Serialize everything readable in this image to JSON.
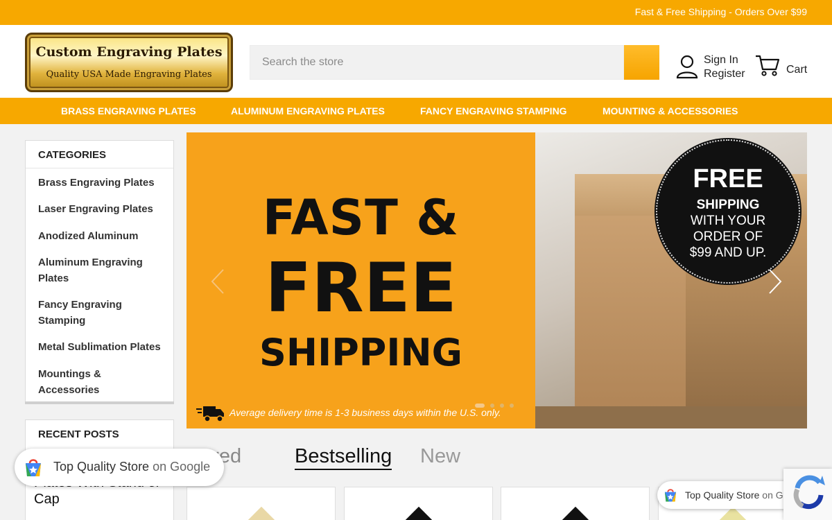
{
  "top_banner": {
    "text": "Fast & Free Shipping - Orders Over $99"
  },
  "logo": {
    "title": "Custom Engraving Plates",
    "tagline": "Quality USA Made Engraving Plates",
    "icon": "logo-plate"
  },
  "search": {
    "placeholder": "Search the store",
    "button_icon": "search-icon"
  },
  "account": {
    "icon": "user-icon",
    "sign_in": "Sign In",
    "register": "Register"
  },
  "cart": {
    "icon": "cart-icon",
    "label": "Cart"
  },
  "nav": {
    "items": [
      {
        "label": "BRASS ENGRAVING PLATES"
      },
      {
        "label": "ALUMINUM ENGRAVING PLATES"
      },
      {
        "label": "FANCY ENGRAVING STAMPING"
      },
      {
        "label": "MOUNTING & ACCESSORIES"
      }
    ]
  },
  "sidebar": {
    "categories_title": "CATEGORIES",
    "categories": [
      "Brass Engraving Plates",
      "Laser Engraving Plates",
      "Anodized Aluminum",
      "Aluminum Engraving Plates",
      "Fancy Engraving Stamping",
      "Metal Sublimation Plates",
      "Mountings & Accessories"
    ],
    "recent_posts_title": "RECENT POSTS",
    "recent_post_fragment": "Plates With Stand or Cap"
  },
  "hero": {
    "headline_1": "FAST &",
    "headline_2": "FREE",
    "headline_3": "SHIPPING",
    "badge_1": "FREE",
    "badge_2": "SHIPPING",
    "badge_3": "WITH YOUR\nORDER OF\n$99 AND UP.",
    "delivery_note": "Average delivery time is 1-3 business days within the U.S. only.",
    "prev_icon": "chevron-left-icon",
    "next_icon": "chevron-right-icon",
    "slides": 4,
    "active_slide": 1
  },
  "product_tabs": [
    {
      "label": "Featured",
      "visible_text": "tured"
    },
    {
      "label": "Bestselling",
      "active": true
    },
    {
      "label": "New"
    }
  ],
  "google_badge": {
    "text": "Top Quality Store",
    "suffix": "on Google",
    "icon": "google-shopping-icon"
  },
  "colors": {
    "accent": "#f7a800",
    "text": "#222222",
    "background": "#f2f2f2"
  }
}
